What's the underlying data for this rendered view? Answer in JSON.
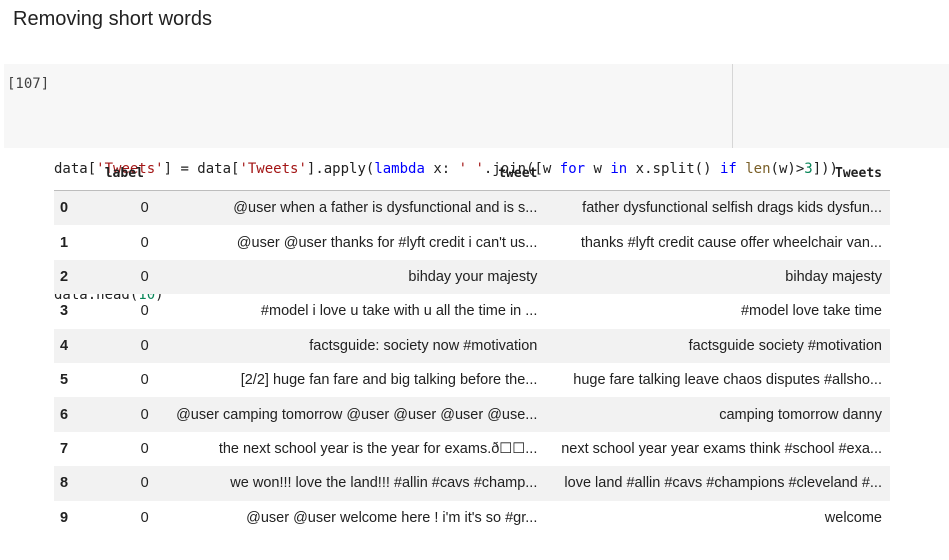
{
  "section_title": "Removing short words",
  "cell": {
    "prompt": "[107]",
    "line1": {
      "p1": "data[",
      "s1": "'Tweets'",
      "p2": "] = data[",
      "s2": "'Tweets'",
      "p3": "].apply(",
      "k1": "lambda",
      "p4": " x: ",
      "s3": "' '",
      "p5": ".join([w ",
      "k2": "for",
      "p6": " w ",
      "k3": "in",
      "p7": " x.split() ",
      "k4": "if",
      "p8": " ",
      "b1": "len",
      "p9": "(w)>",
      "n1": "3",
      "p10": "]))"
    },
    "line2": {
      "p1": "data.head(",
      "n1": "10",
      "p2": ")"
    }
  },
  "table": {
    "headers": [
      "",
      "label",
      "tweet",
      "Tweets"
    ],
    "rows": [
      {
        "idx": "0",
        "label": "0",
        "tweet": "@user when a father is dysfunctional and is s...",
        "tweets": "father dysfunctional selfish drags kids dysfun..."
      },
      {
        "idx": "1",
        "label": "0",
        "tweet": "@user @user thanks for #lyft credit i can't us...",
        "tweets": "thanks #lyft credit cause offer wheelchair van..."
      },
      {
        "idx": "2",
        "label": "0",
        "tweet": "bihday your majesty",
        "tweets": "bihday majesty"
      },
      {
        "idx": "3",
        "label": "0",
        "tweet": "#model i love u take with u all the time in ...",
        "tweets": "#model love take time"
      },
      {
        "idx": "4",
        "label": "0",
        "tweet": "factsguide: society now #motivation",
        "tweets": "factsguide society #motivation"
      },
      {
        "idx": "5",
        "label": "0",
        "tweet": "[2/2] huge fan fare and big talking before the...",
        "tweets": "huge fare talking leave chaos disputes #allsho..."
      },
      {
        "idx": "6",
        "label": "0",
        "tweet": "@user camping tomorrow @user @user @user @use...",
        "tweets": "camping tomorrow danny"
      },
      {
        "idx": "7",
        "label": "0",
        "tweet": "the next school year is the year for exams.ð☐☐...",
        "tweets": "next school year year exams think #school #exa..."
      },
      {
        "idx": "8",
        "label": "0",
        "tweet": "we won!!! love the land!!! #allin #cavs #champ...",
        "tweets": "love land #allin #cavs #champions #cleveland #..."
      },
      {
        "idx": "9",
        "label": "0",
        "tweet": "@user @user welcome here ! i'm it's so #gr...",
        "tweets": "welcome"
      }
    ]
  }
}
